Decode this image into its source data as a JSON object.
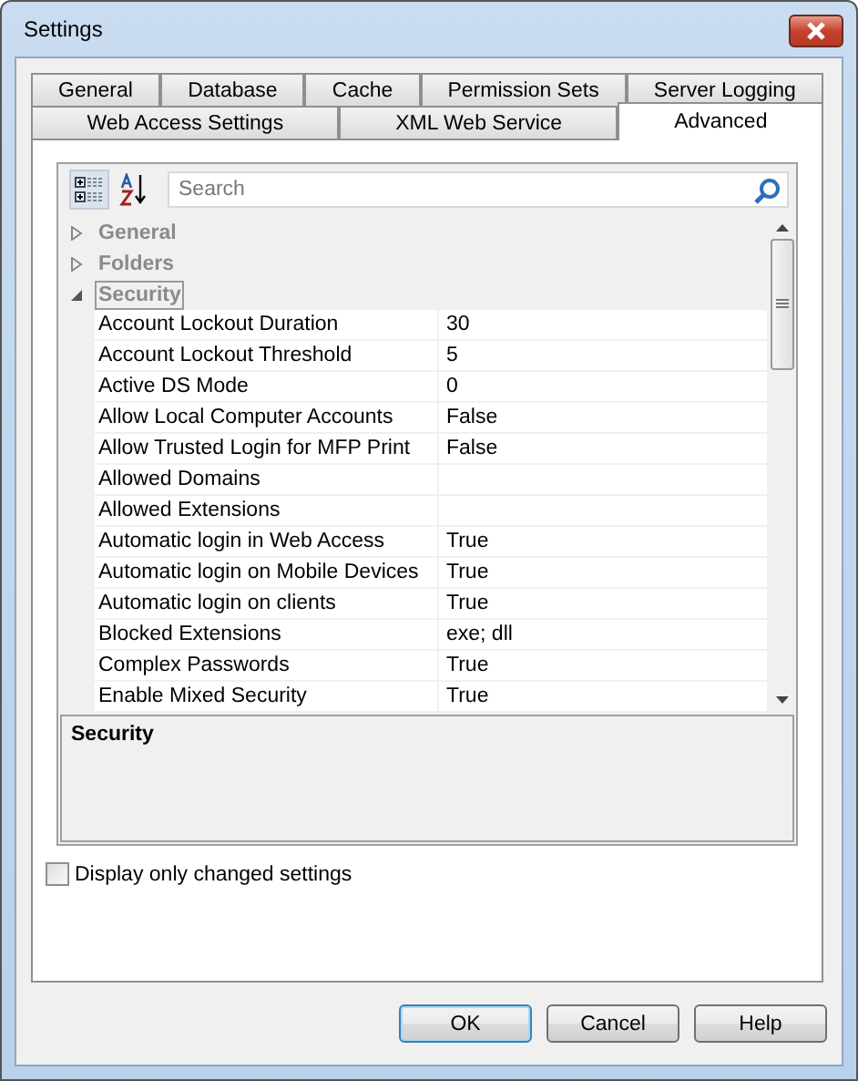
{
  "window": {
    "title": "Settings"
  },
  "tabs": [
    [
      {
        "label": "General",
        "selected": false
      },
      {
        "label": "Database",
        "selected": false
      },
      {
        "label": "Cache",
        "selected": false
      },
      {
        "label": "Permission Sets",
        "selected": false
      },
      {
        "label": "Server Logging",
        "selected": false
      }
    ],
    [
      {
        "label": "Web Access Settings",
        "selected": false
      },
      {
        "label": "XML Web Service",
        "selected": false
      },
      {
        "label": "Advanced",
        "selected": true
      }
    ]
  ],
  "toolbar": {
    "categorized_selected": true,
    "alphabetical_selected": false,
    "search": {
      "placeholder": "Search"
    }
  },
  "categories": [
    {
      "name": "General",
      "expanded": false,
      "selected": false
    },
    {
      "name": "Folders",
      "expanded": false,
      "selected": false
    },
    {
      "name": "Security",
      "expanded": true,
      "selected": true,
      "properties": [
        {
          "name": "Account Lockout Duration",
          "value": "30"
        },
        {
          "name": "Account Lockout Threshold",
          "value": "5"
        },
        {
          "name": "Active DS Mode",
          "value": "0"
        },
        {
          "name": "Allow Local Computer Accounts",
          "value": "False"
        },
        {
          "name": "Allow Trusted Login for MFP Print",
          "value": "False"
        },
        {
          "name": "Allowed Domains"
        },
        {
          "name": "Allowed Extensions"
        },
        {
          "name": "Automatic login in Web Access",
          "value": "True"
        },
        {
          "name": "Automatic login on Mobile Devices",
          "value": "True"
        },
        {
          "name": "Automatic login on clients",
          "value": "True"
        },
        {
          "name": "Blocked Extensions",
          "value": "exe; dll"
        },
        {
          "name": "Complex Passwords",
          "value": "True"
        },
        {
          "name": "Enable Mixed Security",
          "value": "True"
        }
      ]
    }
  ],
  "description": {
    "title": "Security"
  },
  "option": {
    "label": "Display only changed settings",
    "checked": false
  },
  "buttons": [
    {
      "label": "OK",
      "default": true
    },
    {
      "label": "Cancel",
      "default": false
    },
    {
      "label": "Help",
      "default": false
    }
  ]
}
